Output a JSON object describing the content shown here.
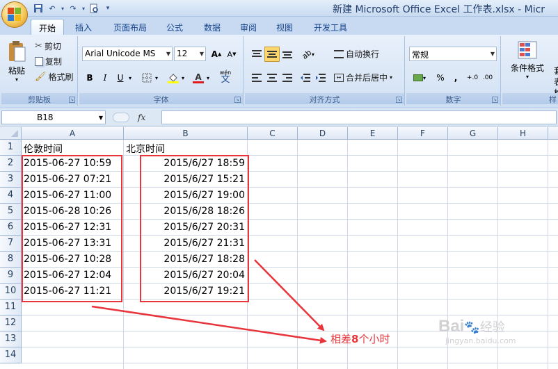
{
  "window": {
    "title": "新建 Microsoft Office Excel 工作表.xlsx - Micr"
  },
  "tabs": [
    "开始",
    "插入",
    "页面布局",
    "公式",
    "数据",
    "审阅",
    "视图",
    "开发工具"
  ],
  "ribbon": {
    "clipboard": {
      "paste": "粘贴",
      "cut": "剪切",
      "copy": "复制",
      "format_painter": "格式刷",
      "label": "剪贴板"
    },
    "font": {
      "font_name": "Arial Unicode MS",
      "font_size": "12",
      "label": "字体",
      "wen": "wén",
      "wen_char": "文"
    },
    "alignment": {
      "wrap": "自动换行",
      "merge": "合并后居中",
      "label": "对齐方式"
    },
    "number": {
      "format": "常规",
      "percent": "%",
      "comma": ",",
      "label": "数字",
      "inc": "+.0",
      "dec": ".00"
    },
    "styles": {
      "conditional": "条件格式",
      "cut_label": "套",
      "cut_label2": "表格"
    },
    "cells_label": "样"
  },
  "formula_bar": {
    "name_box": "B18",
    "fx": "fx",
    "value": ""
  },
  "columns": [
    "A",
    "B",
    "C",
    "D",
    "E",
    "F",
    "G",
    "H"
  ],
  "rows": [
    "1",
    "2",
    "3",
    "4",
    "5",
    "6",
    "7",
    "8",
    "9",
    "10",
    "11",
    "12",
    "13",
    "14"
  ],
  "sheet": {
    "header_a": "伦敦时间",
    "header_b": "北京时间",
    "col_a": [
      "2015-06-27 10:59",
      "2015-06-27 07:21",
      "2015-06-27 11:00",
      "2015-06-28 10:26",
      "2015-06-27 12:31",
      "2015-06-27 13:31",
      "2015-06-27 10:28",
      "2015-06-27 12:04",
      "2015-06-27 11:21"
    ],
    "col_b": [
      "2015/6/27 18:59",
      "2015/6/27 15:21",
      "2015/6/27 19:00",
      "2015/6/28 18:26",
      "2015/6/27 20:31",
      "2015/6/27 21:31",
      "2015/6/27 18:28",
      "2015/6/27 20:04",
      "2015/6/27 19:21"
    ]
  },
  "annotation": {
    "prefix": "相差",
    "number": "8",
    "suffix": "个小时",
    "color": "#e8353b"
  },
  "watermark": {
    "logo": "Bai",
    "logo2": "经验",
    "url": "jingyan.baidu.com"
  }
}
